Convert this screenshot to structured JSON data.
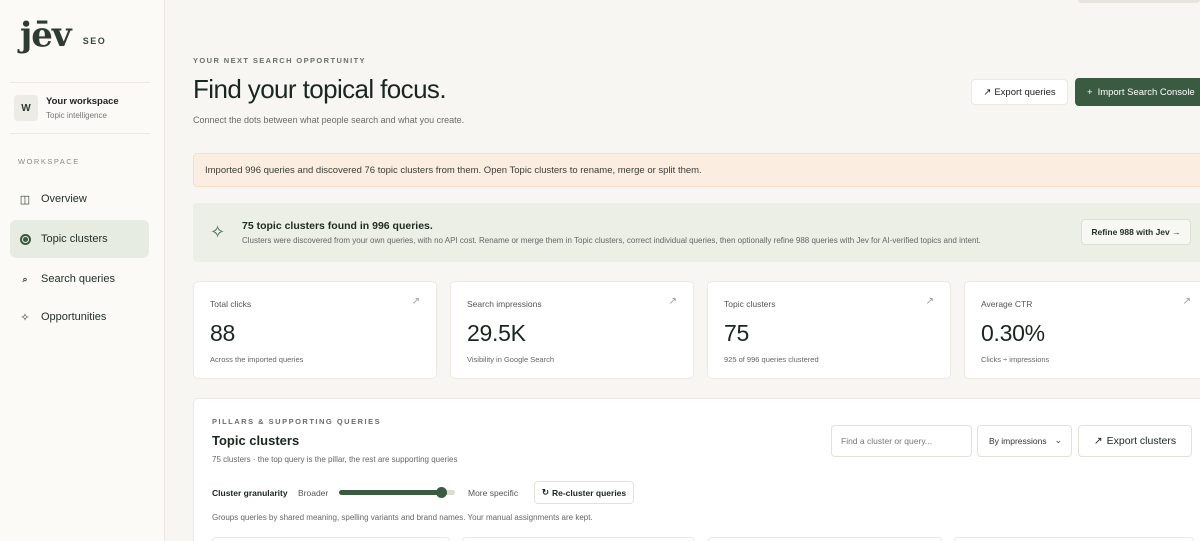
{
  "brand": {
    "mark": "jēv",
    "suffix": "SEO"
  },
  "workspace": {
    "initial": "W",
    "name": "Your workspace",
    "subtitle": "Topic intelligence"
  },
  "sidebar": {
    "section": "WORKSPACE",
    "items": [
      {
        "label": "Overview",
        "icon": "columns-icon",
        "active": false
      },
      {
        "label": "Topic clusters",
        "icon": "target-icon",
        "active": true
      },
      {
        "label": "Search queries",
        "icon": "search-icon",
        "active": false
      },
      {
        "label": "Opportunities",
        "icon": "sparkle-icon",
        "active": false
      }
    ]
  },
  "header": {
    "eyebrow": "YOUR NEXT SEARCH OPPORTUNITY",
    "title": "Find your topical focus.",
    "subtitle": "Connect the dots between what people search and what you create.",
    "export_label": "Export queries",
    "import_label": "Import Search Console"
  },
  "notice": "Imported 996 queries and discovered 76 topic clusters from them. Open Topic clusters to rename, merge or split them.",
  "discovery": {
    "title": "75 topic clusters found in 996 queries.",
    "description": "Clusters were discovered from your own queries, with no API cost. Rename or merge them in Topic clusters, correct individual queries, then optionally refine 988 queries with Jev for AI-verified topics and intent.",
    "button": "Refine 988 with Jev →"
  },
  "stats": [
    {
      "label": "Total clicks",
      "value": "88",
      "note": "Across the imported queries"
    },
    {
      "label": "Search impressions",
      "value": "29.5K",
      "note": "Visibility in Google Search"
    },
    {
      "label": "Topic clusters",
      "value": "75",
      "note": "925 of 996 queries clustered"
    },
    {
      "label": "Average CTR",
      "value": "0.30%",
      "note": "Clicks ÷ impressions"
    }
  ],
  "clusters": {
    "eyebrow": "PILLARS & SUPPORTING QUERIES",
    "title": "Topic clusters",
    "subtitle": "75 clusters · the top query is the pillar, the rest are supporting queries",
    "search_placeholder": "Find a cluster or query...",
    "sort_value": "By impressions",
    "export_label": "Export clusters",
    "granularity_label": "Cluster granularity",
    "broader": "Broader",
    "more_specific": "More specific",
    "granularity_level": 0.88,
    "recluster_label": "Re-cluster queries",
    "note": "Groups queries by shared meaning, spelling variants and brand names. Your manual assignments are kept."
  },
  "colors": {
    "accent": "#3a5a42",
    "notice_bg": "#fbeee0",
    "banner_bg": "#ebefe6"
  }
}
